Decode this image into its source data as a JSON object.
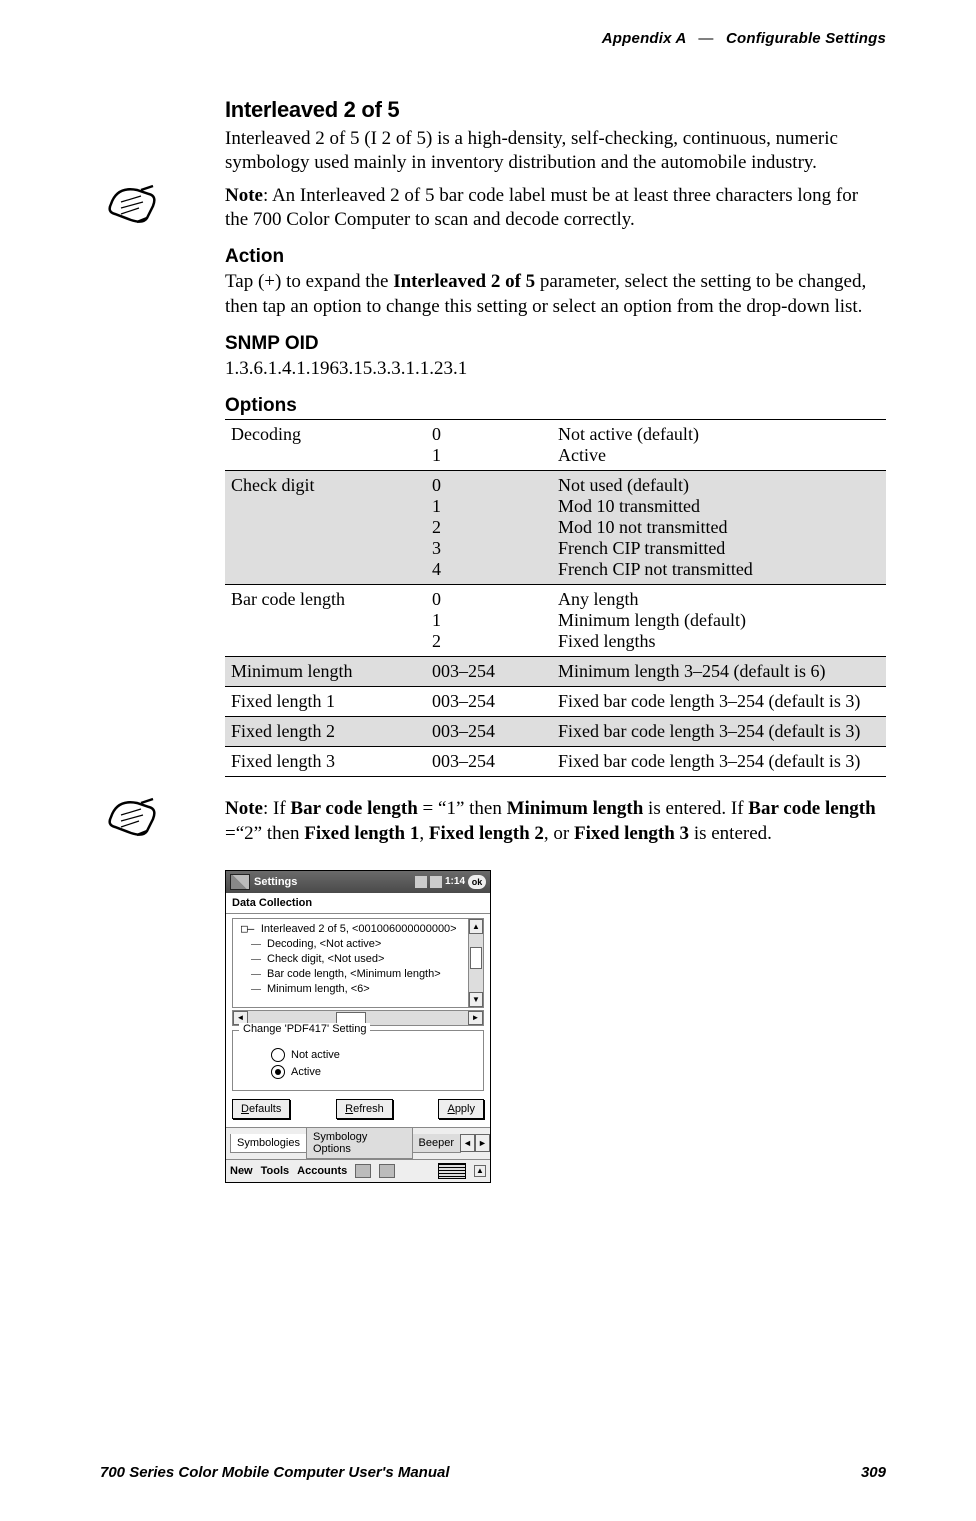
{
  "header": {
    "left": "Appendix A",
    "sep": "—",
    "right": "Configurable Settings"
  },
  "title": "Interleaved 2 of 5",
  "intro": "Interleaved 2 of 5 (I 2 of 5) is a high-density, self-checking, continuous, numeric symbology used mainly in inventory distribution and the automobile industry.",
  "note1_label": "Note",
  "note1_text": ": An Interleaved 2 of 5 bar code label must be at least three characters long for the 700 Color Computer to scan and decode correctly.",
  "action_head": "Action",
  "action_p1a": "Tap (+) to expand the ",
  "action_p1_bold": "Interleaved 2 of 5",
  "action_p1b": " parameter, select the setting to be changed, then tap an option to change this setting or select an option from the drop-down list.",
  "snmp_head": "SNMP OID",
  "snmp_value": "1.3.6.1.4.1.1963.15.3.3.1.1.23.1",
  "options_head": "Options",
  "options": [
    {
      "name": "Decoding",
      "codes": "0\n1",
      "desc": "Not active (default)\nActive",
      "shade": false
    },
    {
      "name": "Check digit",
      "codes": "0\n1\n2\n3\n4",
      "desc": "Not used (default)\nMod 10 transmitted\nMod 10 not transmitted\nFrench CIP transmitted\nFrench CIP not transmitted",
      "shade": true
    },
    {
      "name": "Bar code length",
      "codes": "0\n1\n2",
      "desc": "Any length\nMinimum length (default)\nFixed lengths",
      "shade": false
    },
    {
      "name": "Minimum length",
      "codes": "003–254",
      "desc": "Minimum length 3–254 (default is 6)",
      "shade": true
    },
    {
      "name": "Fixed length 1",
      "codes": "003–254",
      "desc": "Fixed bar code length 3–254 (default is 3)",
      "shade": false
    },
    {
      "name": "Fixed length 2",
      "codes": "003–254",
      "desc": "Fixed bar code length 3–254 (default is 3)",
      "shade": true
    },
    {
      "name": "Fixed length 3",
      "codes": "003–254",
      "desc": "Fixed bar code length 3–254 (default is 3)",
      "shade": false
    }
  ],
  "note2": {
    "label": "Note",
    "seg1": ": If ",
    "b1": "Bar code length",
    "seg2": " = “1” then ",
    "b2": "Minimum length",
    "seg3": " is entered. If ",
    "b3": "Bar code length",
    "seg4": " =“2” then ",
    "b4": "Fixed length 1",
    "seg5": ", ",
    "b5": "Fixed length 2",
    "seg6": ", or ",
    "b6": "Fixed length 3",
    "seg7": " is entered."
  },
  "device": {
    "title": "Settings",
    "clock": "1:14",
    "ok": "ok",
    "section": "Data Collection",
    "tree_parent": "Interleaved 2 of 5, <001006000000000>",
    "tree": [
      "Decoding, <Not active>",
      "Check digit, <Not used>",
      "Bar code length, <Minimum length>",
      "Minimum length, <6>"
    ],
    "group_legend": "Change 'PDF417' Setting",
    "radio1": "Not active",
    "radio2": "Active",
    "btn_defaults_u": "D",
    "btn_defaults_rest": "efaults",
    "btn_refresh_u": "R",
    "btn_refresh_rest": "efresh",
    "btn_apply_u": "A",
    "btn_apply_rest": "pply",
    "tabs": [
      "Symbologies",
      "Symbology Options",
      "Beeper"
    ],
    "status": [
      "New",
      "Tools",
      "Accounts"
    ]
  },
  "footer": {
    "left": "700 Series Color Mobile Computer User's Manual",
    "right": "309"
  }
}
